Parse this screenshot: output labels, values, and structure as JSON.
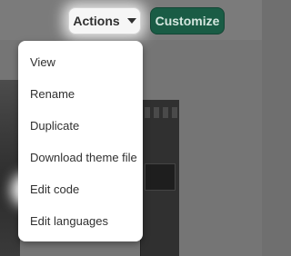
{
  "header": {
    "actions_label": "Actions",
    "customize_label": "Customize"
  },
  "menu": {
    "items": [
      {
        "label": "View"
      },
      {
        "label": "Rename"
      },
      {
        "label": "Duplicate"
      },
      {
        "label": "Download theme file"
      },
      {
        "label": "Edit code"
      },
      {
        "label": "Edit languages"
      }
    ]
  },
  "colors": {
    "primary_button_bg": "#1a5c45",
    "menu_bg": "#ffffff",
    "text": "#303030"
  },
  "icons": {
    "actions_caret": "chevron-down-icon"
  }
}
